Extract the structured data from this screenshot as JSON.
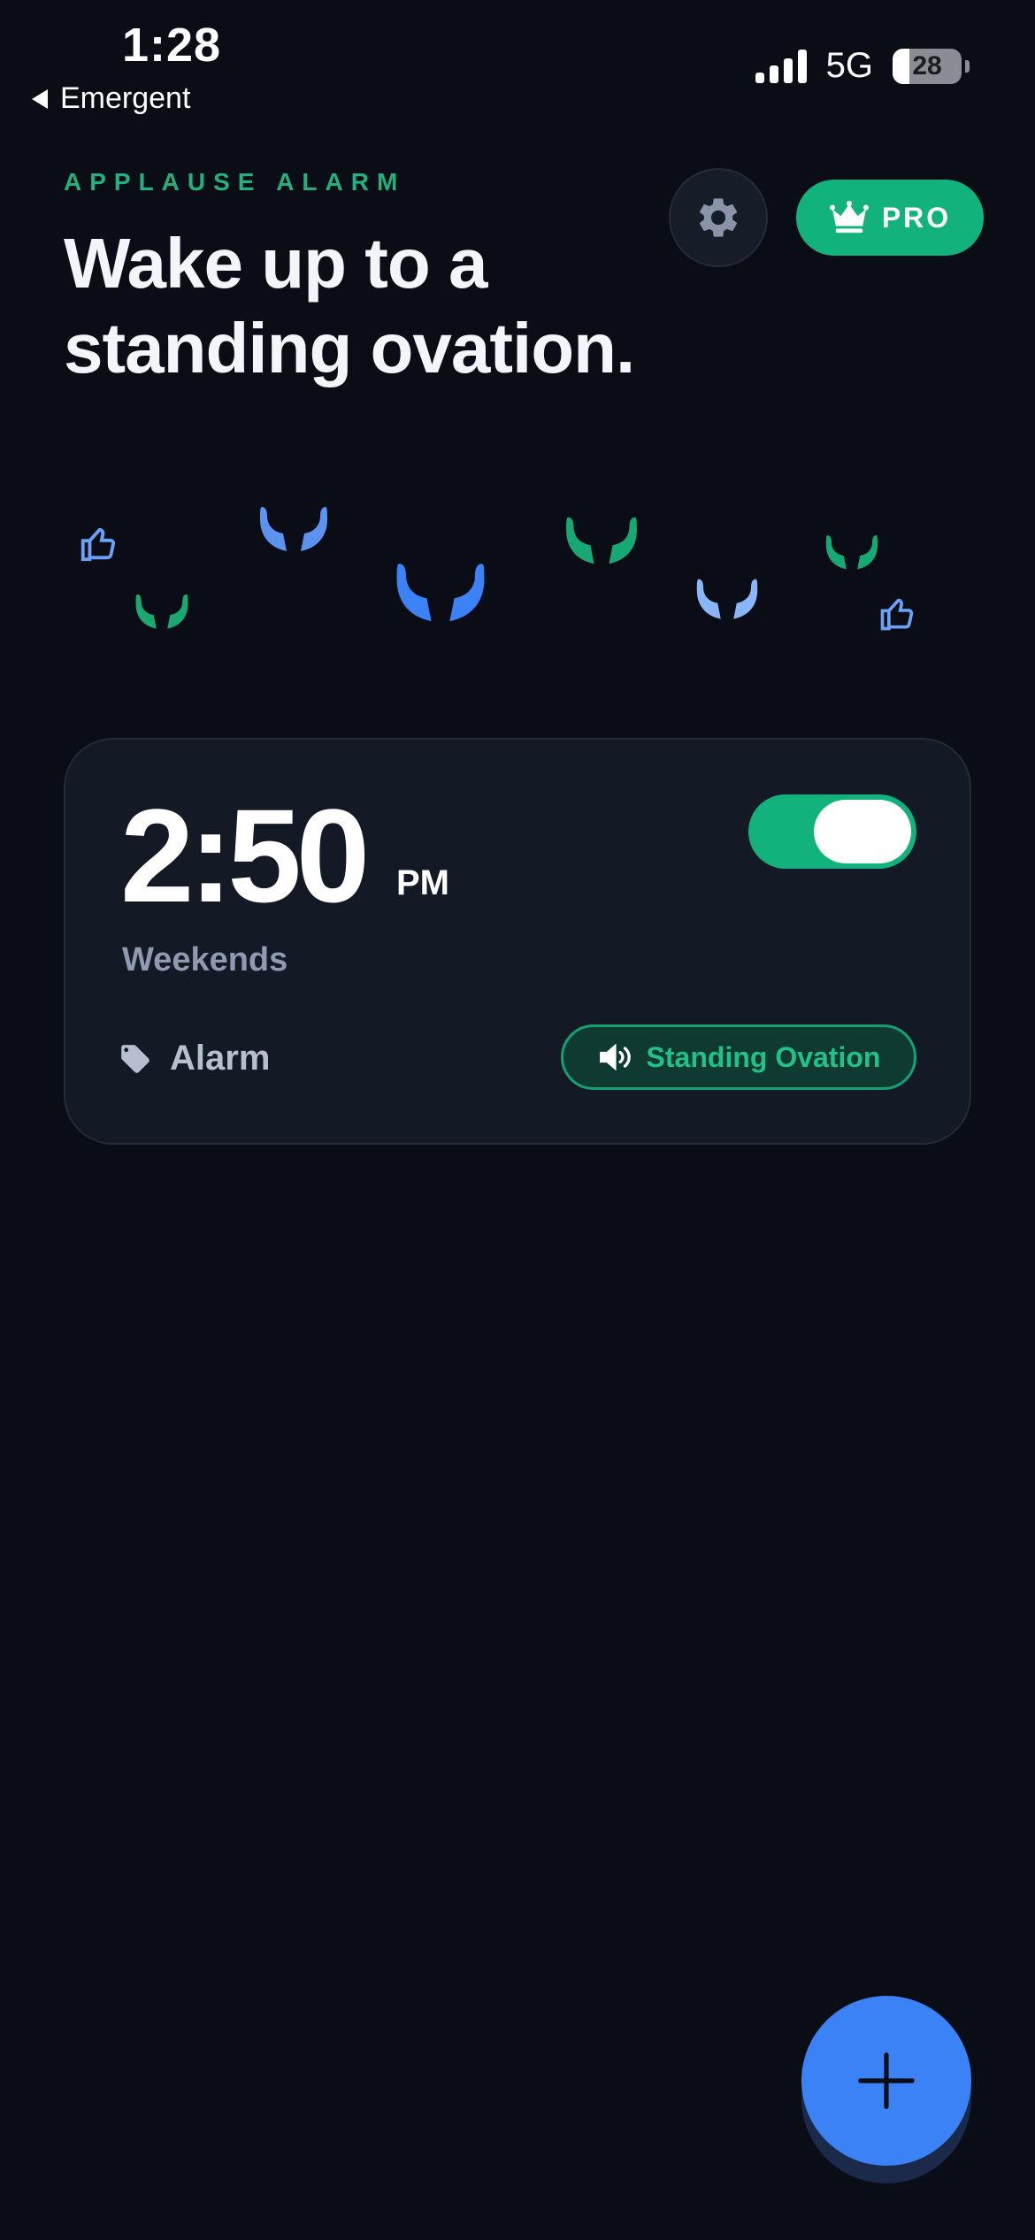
{
  "status_bar": {
    "time": "1:28",
    "back_label": "Emergent",
    "network": "5G",
    "battery": "28"
  },
  "header": {
    "eyebrow": "APPLAUSE ALARM",
    "headline": "Wake up to a standing ovation.",
    "pro_label": "PRO"
  },
  "alarms": [
    {
      "time": "2:50",
      "ampm": "PM",
      "days": "Weekends",
      "label": "Alarm",
      "sound": "Standing Ovation",
      "enabled": true
    }
  ],
  "colors": {
    "background": "#0a0d16",
    "accent_green": "#12b27d",
    "accent_blue": "#3b82f6",
    "card": "#131a26",
    "muted_text": "#8f9ab0"
  },
  "icons": {
    "settings": "gear-icon",
    "pro": "crown-icon",
    "label": "tag-icon",
    "sound": "speaker-icon",
    "add": "plus-icon",
    "decor": [
      "clapping-hands-icon",
      "thumbs-up-icon"
    ]
  }
}
